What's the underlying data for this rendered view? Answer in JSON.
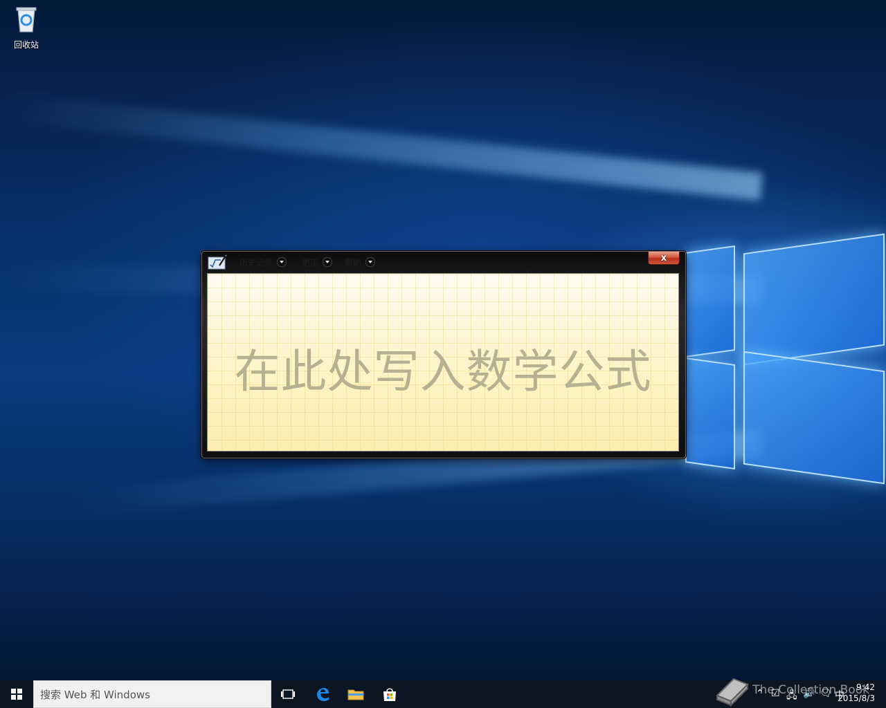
{
  "desktop": {
    "recycle_bin_label": "回收站"
  },
  "math_panel": {
    "menus": [
      {
        "label": "历史记录"
      },
      {
        "label": "更正"
      },
      {
        "label": "帮助"
      }
    ],
    "close_label": "x",
    "prompt": "在此处写入数学公式"
  },
  "taskbar": {
    "search_placeholder": "搜索 Web 和 Windows",
    "ime_label": "中",
    "time": "9:42",
    "date": "2015/8/3",
    "watermark": "The Collection Book"
  },
  "colors": {
    "accent": "#0a3a80",
    "close": "#c8402a",
    "paper": "#fdf4c8",
    "prompt_text": "#b7b192"
  }
}
